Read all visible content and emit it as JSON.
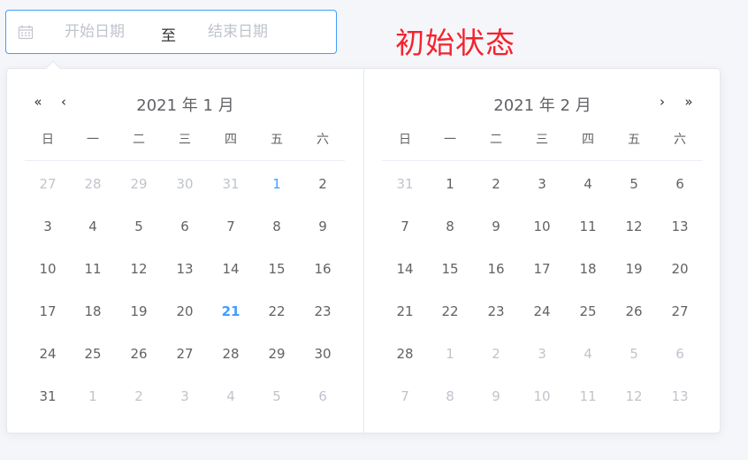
{
  "range_input": {
    "start_placeholder": "开始日期",
    "separator": "至",
    "end_placeholder": "结束日期",
    "icon": "calendar-icon"
  },
  "status_note": "初始状态",
  "weekdays": [
    "日",
    "一",
    "二",
    "三",
    "四",
    "五",
    "六"
  ],
  "left_panel": {
    "title": "2021 年 1 月",
    "nav_prev_year": "«",
    "nav_prev_month": "‹",
    "weeks": [
      [
        {
          "d": "27",
          "t": "prev"
        },
        {
          "d": "28",
          "t": "prev"
        },
        {
          "d": "29",
          "t": "prev"
        },
        {
          "d": "30",
          "t": "prev"
        },
        {
          "d": "31",
          "t": "prev"
        },
        {
          "d": "1",
          "t": "start"
        },
        {
          "d": "2",
          "t": "cur"
        }
      ],
      [
        {
          "d": "3",
          "t": "cur"
        },
        {
          "d": "4",
          "t": "cur"
        },
        {
          "d": "5",
          "t": "cur"
        },
        {
          "d": "6",
          "t": "cur"
        },
        {
          "d": "7",
          "t": "cur"
        },
        {
          "d": "8",
          "t": "cur"
        },
        {
          "d": "9",
          "t": "cur"
        }
      ],
      [
        {
          "d": "10",
          "t": "cur"
        },
        {
          "d": "11",
          "t": "cur"
        },
        {
          "d": "12",
          "t": "cur"
        },
        {
          "d": "13",
          "t": "cur"
        },
        {
          "d": "14",
          "t": "cur"
        },
        {
          "d": "15",
          "t": "cur"
        },
        {
          "d": "16",
          "t": "cur"
        }
      ],
      [
        {
          "d": "17",
          "t": "cur"
        },
        {
          "d": "18",
          "t": "cur"
        },
        {
          "d": "19",
          "t": "cur"
        },
        {
          "d": "20",
          "t": "cur"
        },
        {
          "d": "21",
          "t": "today"
        },
        {
          "d": "22",
          "t": "cur"
        },
        {
          "d": "23",
          "t": "cur"
        }
      ],
      [
        {
          "d": "24",
          "t": "cur"
        },
        {
          "d": "25",
          "t": "cur"
        },
        {
          "d": "26",
          "t": "cur"
        },
        {
          "d": "27",
          "t": "cur"
        },
        {
          "d": "28",
          "t": "cur"
        },
        {
          "d": "29",
          "t": "cur"
        },
        {
          "d": "30",
          "t": "cur"
        }
      ],
      [
        {
          "d": "31",
          "t": "cur"
        },
        {
          "d": "1",
          "t": "next"
        },
        {
          "d": "2",
          "t": "next"
        },
        {
          "d": "3",
          "t": "next"
        },
        {
          "d": "4",
          "t": "next"
        },
        {
          "d": "5",
          "t": "next"
        },
        {
          "d": "6",
          "t": "next"
        }
      ]
    ]
  },
  "right_panel": {
    "title": "2021 年 2 月",
    "nav_next_month": "›",
    "nav_next_year": "»",
    "weeks": [
      [
        {
          "d": "31",
          "t": "prev"
        },
        {
          "d": "1",
          "t": "cur"
        },
        {
          "d": "2",
          "t": "cur"
        },
        {
          "d": "3",
          "t": "cur"
        },
        {
          "d": "4",
          "t": "cur"
        },
        {
          "d": "5",
          "t": "cur"
        },
        {
          "d": "6",
          "t": "cur"
        }
      ],
      [
        {
          "d": "7",
          "t": "cur"
        },
        {
          "d": "8",
          "t": "cur"
        },
        {
          "d": "9",
          "t": "cur"
        },
        {
          "d": "10",
          "t": "cur"
        },
        {
          "d": "11",
          "t": "cur"
        },
        {
          "d": "12",
          "t": "cur"
        },
        {
          "d": "13",
          "t": "cur"
        }
      ],
      [
        {
          "d": "14",
          "t": "cur"
        },
        {
          "d": "15",
          "t": "cur"
        },
        {
          "d": "16",
          "t": "cur"
        },
        {
          "d": "17",
          "t": "cur"
        },
        {
          "d": "18",
          "t": "cur"
        },
        {
          "d": "19",
          "t": "cur"
        },
        {
          "d": "20",
          "t": "cur"
        }
      ],
      [
        {
          "d": "21",
          "t": "cur"
        },
        {
          "d": "22",
          "t": "cur"
        },
        {
          "d": "23",
          "t": "cur"
        },
        {
          "d": "24",
          "t": "cur"
        },
        {
          "d": "25",
          "t": "cur"
        },
        {
          "d": "26",
          "t": "cur"
        },
        {
          "d": "27",
          "t": "cur"
        }
      ],
      [
        {
          "d": "28",
          "t": "cur"
        },
        {
          "d": "1",
          "t": "next"
        },
        {
          "d": "2",
          "t": "next"
        },
        {
          "d": "3",
          "t": "next"
        },
        {
          "d": "4",
          "t": "next"
        },
        {
          "d": "5",
          "t": "next"
        },
        {
          "d": "6",
          "t": "next"
        }
      ],
      [
        {
          "d": "7",
          "t": "next"
        },
        {
          "d": "8",
          "t": "next"
        },
        {
          "d": "9",
          "t": "next"
        },
        {
          "d": "10",
          "t": "next"
        },
        {
          "d": "11",
          "t": "next"
        },
        {
          "d": "12",
          "t": "next"
        },
        {
          "d": "13",
          "t": "next"
        }
      ]
    ]
  },
  "colors": {
    "accent": "#409eff",
    "note": "#f5222d",
    "text": "#606266",
    "muted": "#c0c4cc"
  }
}
